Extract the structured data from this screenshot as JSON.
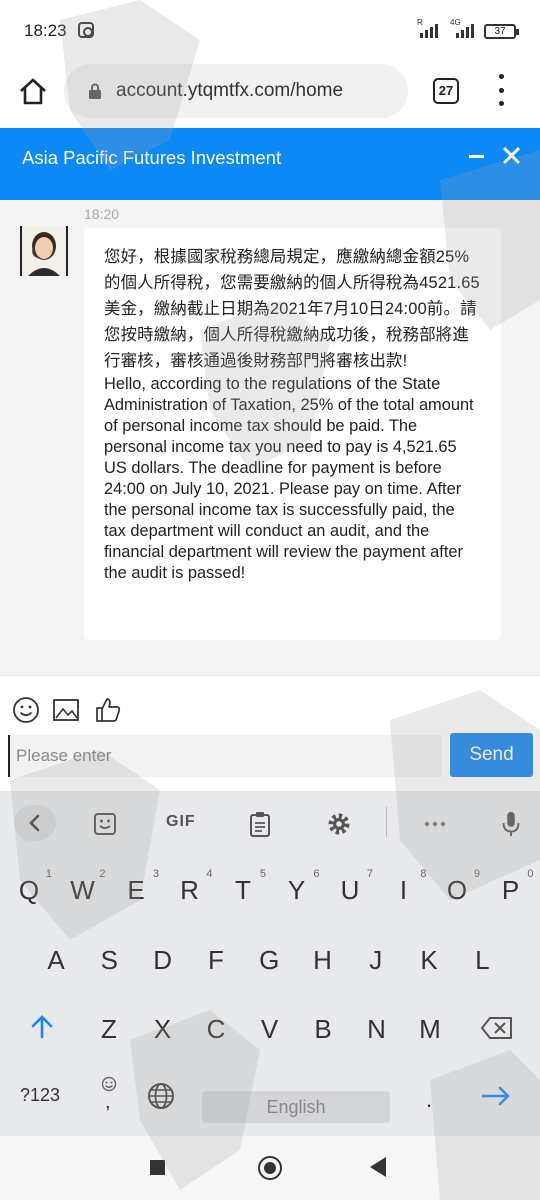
{
  "status_bar": {
    "time": "18:23",
    "signal_tag_1": "R",
    "signal_tag_2": "4G",
    "battery": "37"
  },
  "browser": {
    "url": "account.ytqmtfx.com/home",
    "tab_count": "27"
  },
  "chat": {
    "title": "Asia Pacific Futures Investment",
    "message_time": "18:20",
    "message_cn": "您好，根據國家稅務總局規定，應繳納總金額25%的個人所得稅，您需要繳納的個人所得稅為4521.65美金，繳納截止日期為2021年7月10日24:00前。請您按時繳納，個人所得稅繳納成功後，稅務部將進行審核，審核通過後財務部門將審核出款!",
    "message_en": "Hello, according to the regulations of the State Administration of Taxation, 25% of the total amount of personal income tax should be paid. The personal income tax you need to pay is 4,521.65 US dollars. The deadline for payment is before 24:00 on July 10, 2021. Please pay on time. After the personal income tax is successfully paid, the tax department will conduct an audit, and the financial department will review the payment after the audit is passed!"
  },
  "toolbar": {
    "icons": [
      "smile-icon",
      "image-icon",
      "thumbs-up-icon"
    ]
  },
  "input": {
    "placeholder": "Please enter",
    "send_label": "Send"
  },
  "keyboard": {
    "gif_label": "GIF",
    "row1": [
      {
        "key": "Q",
        "hint": "1"
      },
      {
        "key": "W",
        "hint": "2"
      },
      {
        "key": "E",
        "hint": "3"
      },
      {
        "key": "R",
        "hint": "4"
      },
      {
        "key": "T",
        "hint": "5"
      },
      {
        "key": "Y",
        "hint": "6"
      },
      {
        "key": "U",
        "hint": "7"
      },
      {
        "key": "I",
        "hint": "8"
      },
      {
        "key": "O",
        "hint": "9"
      },
      {
        "key": "P",
        "hint": "0"
      }
    ],
    "row2": [
      "A",
      "S",
      "D",
      "F",
      "G",
      "H",
      "J",
      "K",
      "L"
    ],
    "row3": [
      "Z",
      "X",
      "C",
      "V",
      "B",
      "N",
      "M"
    ],
    "symbols_label": "?123",
    "comma_label": ",",
    "space_label": "English",
    "period_label": "."
  },
  "colors": {
    "header_blue": "#0d89f6",
    "send_blue": "#1a86ee",
    "keyboard_bg": "#e7e9ec"
  }
}
